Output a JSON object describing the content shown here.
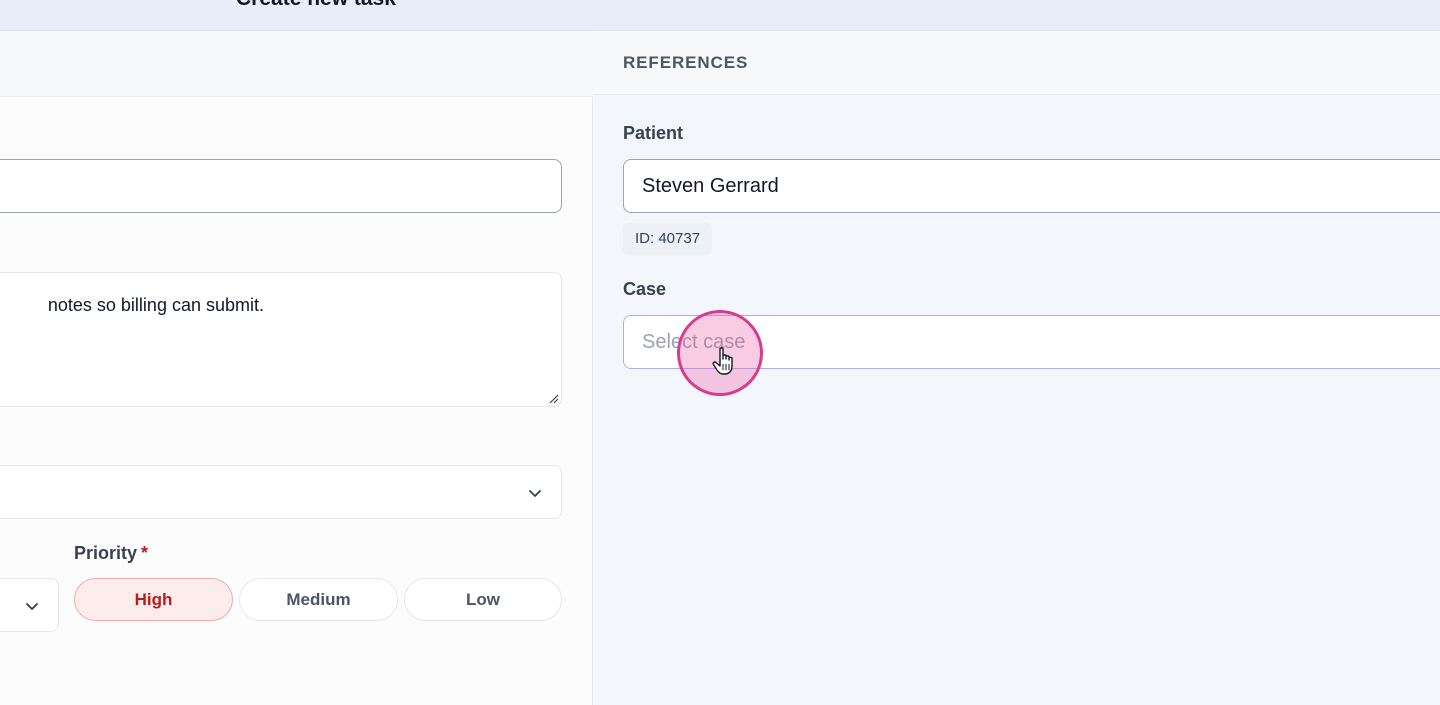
{
  "modal": {
    "title": "Create new task"
  },
  "left": {
    "description_text": "notes so billing can submit.",
    "priority": {
      "label": "Priority",
      "required_mark": "*",
      "options": [
        "High",
        "Medium",
        "Low"
      ],
      "selected": "High"
    }
  },
  "references": {
    "section_title": "REFERENCES",
    "patient": {
      "label": "Patient",
      "value": "Steven Gerrard",
      "id_chip": "ID: 40737"
    },
    "case": {
      "label": "Case",
      "placeholder": "Select case"
    }
  },
  "colors": {
    "accent": "#d63c8f",
    "priority_high": "#b91c1c",
    "priority_high_bg": "#fdecec"
  },
  "icons": [
    "chevron-down-icon",
    "resize-handle-icon",
    "hand-pointer-icon"
  ]
}
